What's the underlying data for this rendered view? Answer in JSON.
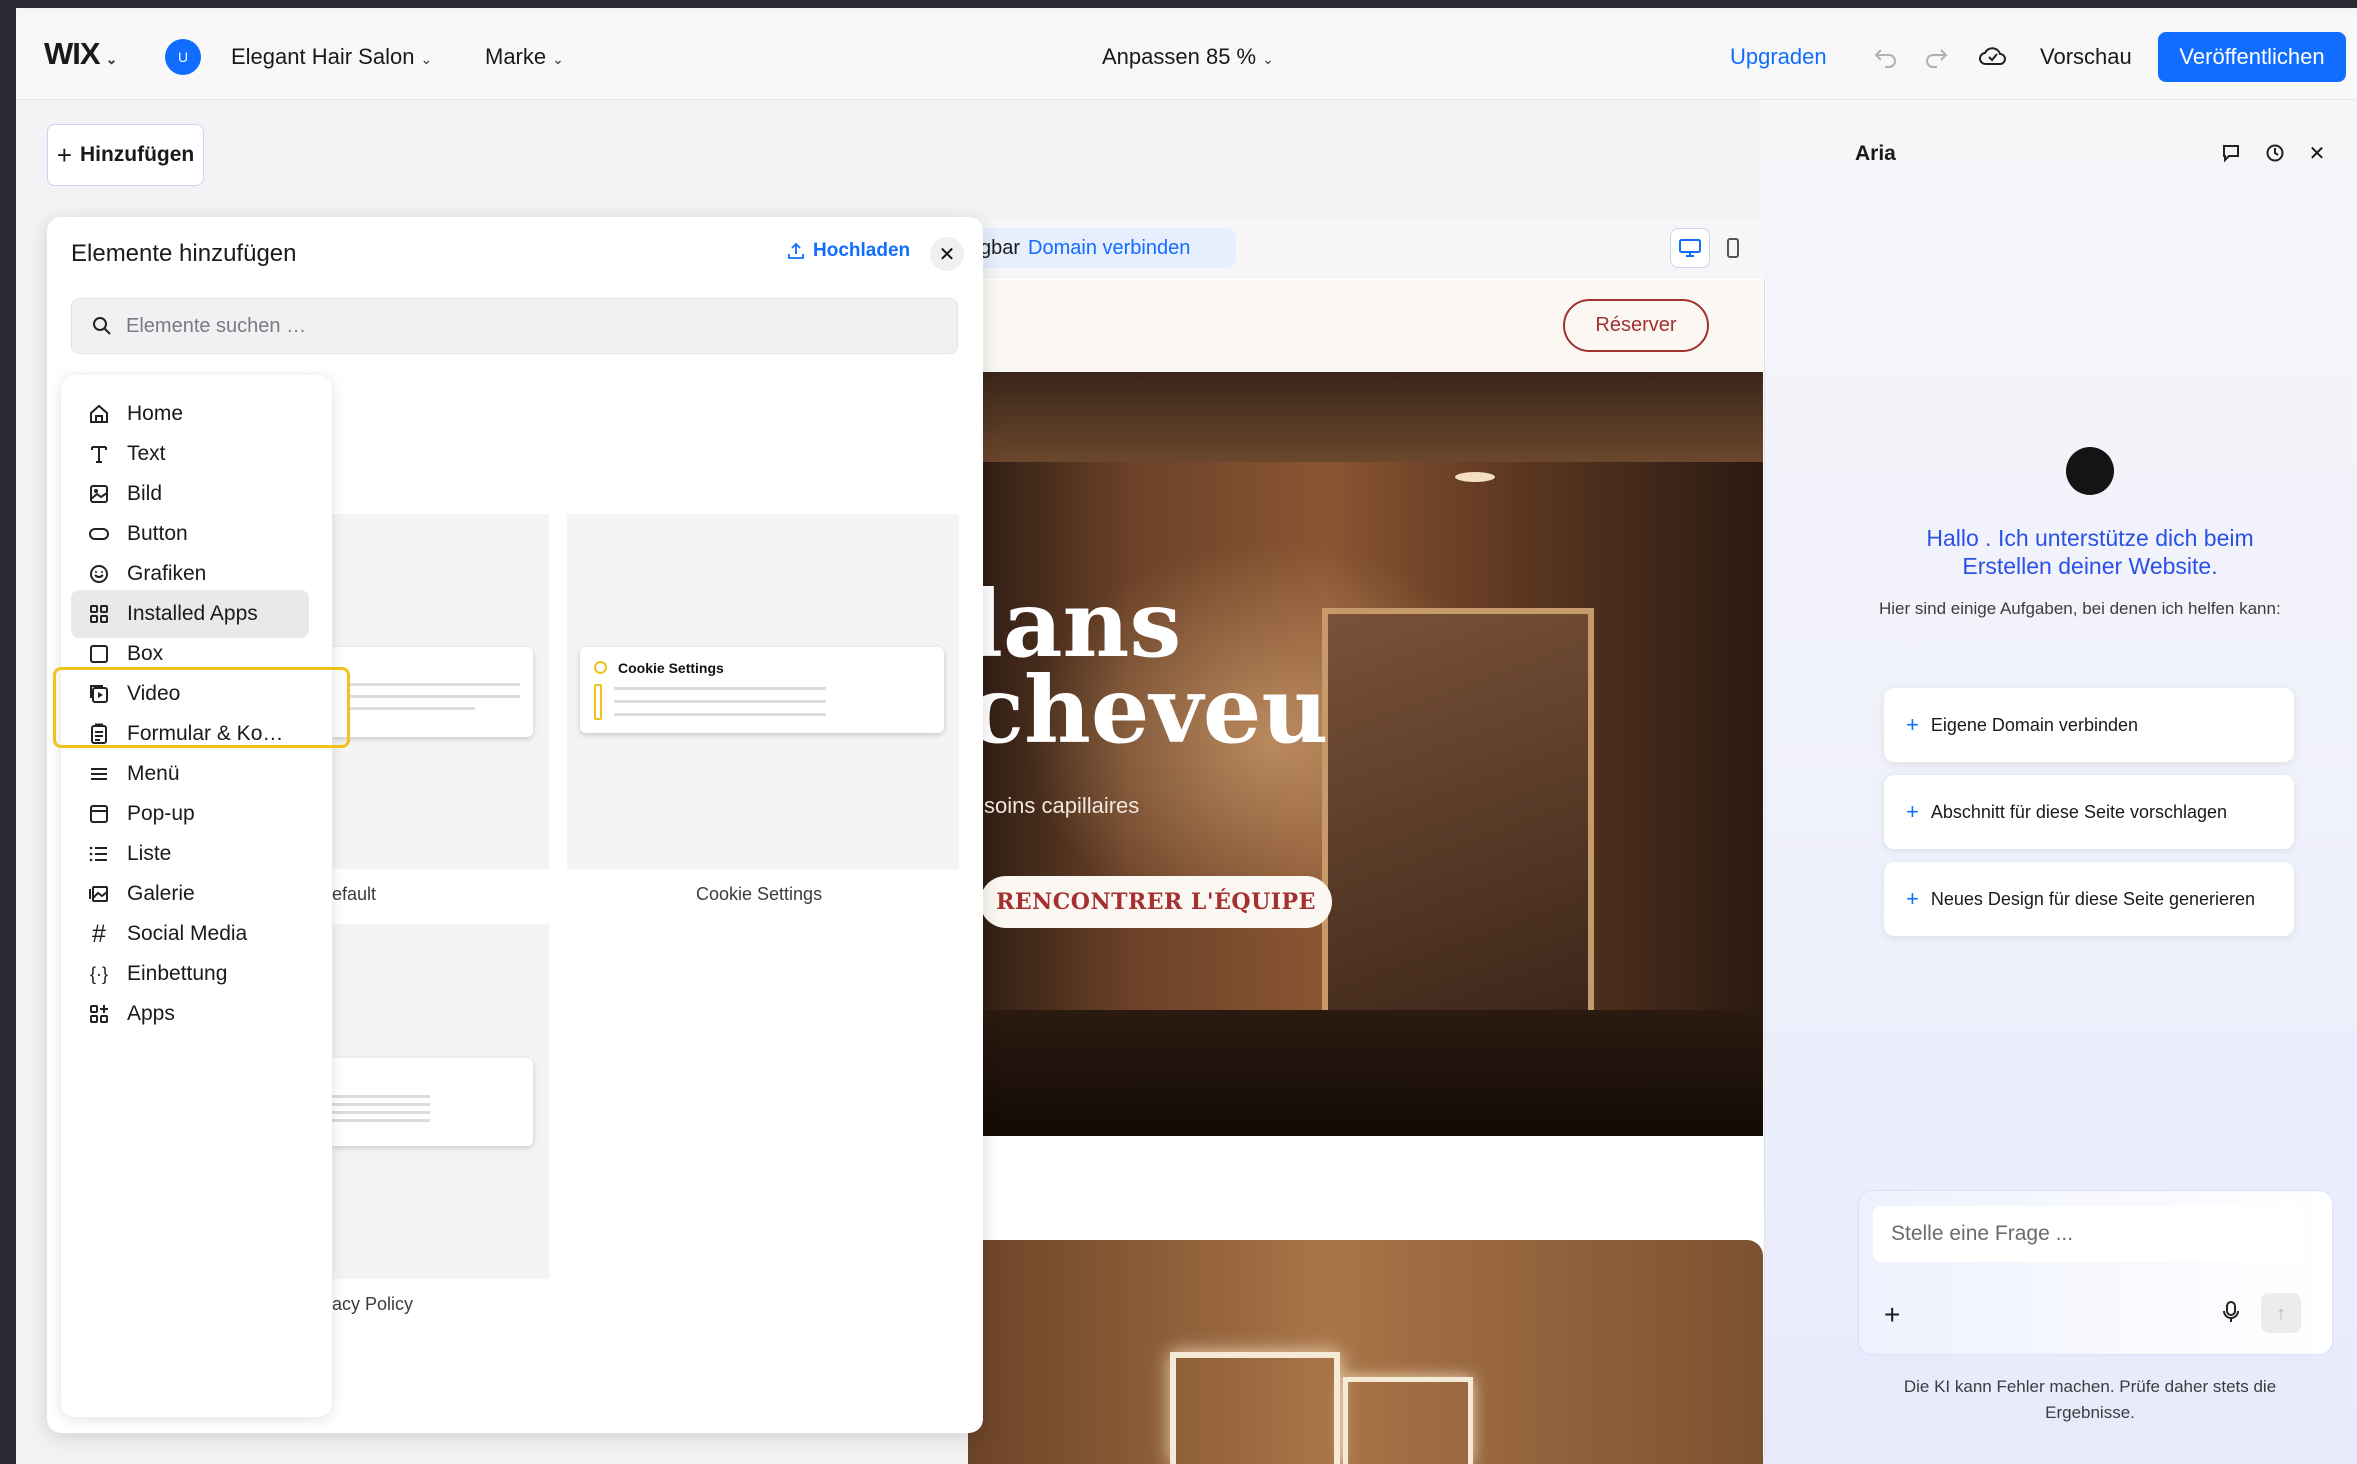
{
  "header": {
    "logo": "WIX",
    "avatar_initial": "U",
    "site_name": "Elegant Hair Salon",
    "brand_menu": "Marke",
    "zoom_label": "Anpassen 85 %",
    "upgrade": "Upgraden",
    "preview": "Vorschau",
    "publish": "Veröffentlichen"
  },
  "toolbar": {
    "add_button": "Hinzufügen"
  },
  "panel": {
    "title": "Elemente hinzufügen",
    "upload": "Hochladen",
    "close": "✕",
    "search_placeholder": "Elemente suchen …",
    "categories": [
      {
        "label": "Home",
        "icon": "home-icon"
      },
      {
        "label": "Text",
        "icon": "text-icon"
      },
      {
        "label": "Bild",
        "icon": "image-icon"
      },
      {
        "label": "Button",
        "icon": "button-icon"
      },
      {
        "label": "Grafiken",
        "icon": "smiley-icon"
      },
      {
        "label": "Installed Apps",
        "icon": "grid-apps-icon",
        "selected": true
      },
      {
        "label": "Box",
        "icon": "box-icon"
      },
      {
        "label": "Video",
        "icon": "video-icon"
      },
      {
        "label": "Formular & Ko…",
        "icon": "form-icon"
      },
      {
        "label": "Menü",
        "icon": "menu-icon"
      },
      {
        "label": "Pop-up",
        "icon": "popup-icon"
      },
      {
        "label": "Liste",
        "icon": "list-icon"
      },
      {
        "label": "Galerie",
        "icon": "gallery-icon"
      },
      {
        "label": "Social Media",
        "icon": "hashtag-icon"
      },
      {
        "label": "Einbettung",
        "icon": "embed-icon"
      },
      {
        "label": "Apps",
        "icon": "apps-icon"
      }
    ],
    "cards": [
      {
        "label": "efault"
      },
      {
        "label": "Cookie Settings",
        "inner_title": "Cookie Settings"
      },
      {
        "label": "acy Policy"
      }
    ]
  },
  "site": {
    "domain_prefix": "gbar",
    "domain_link": "Domain verbinden",
    "reserve": "Réserver",
    "hero_line1": "lans",
    "hero_line2": "cheveu",
    "hero_sub": "soins capillaires",
    "team_button": "RENCONTRER L'ÉQUIPE"
  },
  "aria": {
    "title": "Aria",
    "greeting": "Hallo . Ich unterstütze dich beim Erstellen deiner Website.",
    "hint": "Hier sind einige Aufgaben, bei denen ich helfen kann:",
    "suggestions": [
      "Eigene Domain verbinden",
      "Abschnitt für diese Seite vorschlagen",
      "Neues Design für diese Seite generieren"
    ],
    "chat_placeholder": "Stelle eine Frage ...",
    "disclaimer": "Die KI kann Fehler machen. Prüfe daher stets die Ergebnisse."
  },
  "colors": {
    "accent": "#116dff",
    "brand_red": "#a4302f",
    "highlight": "#f1c21b",
    "aria_blue": "#2b50e6"
  }
}
